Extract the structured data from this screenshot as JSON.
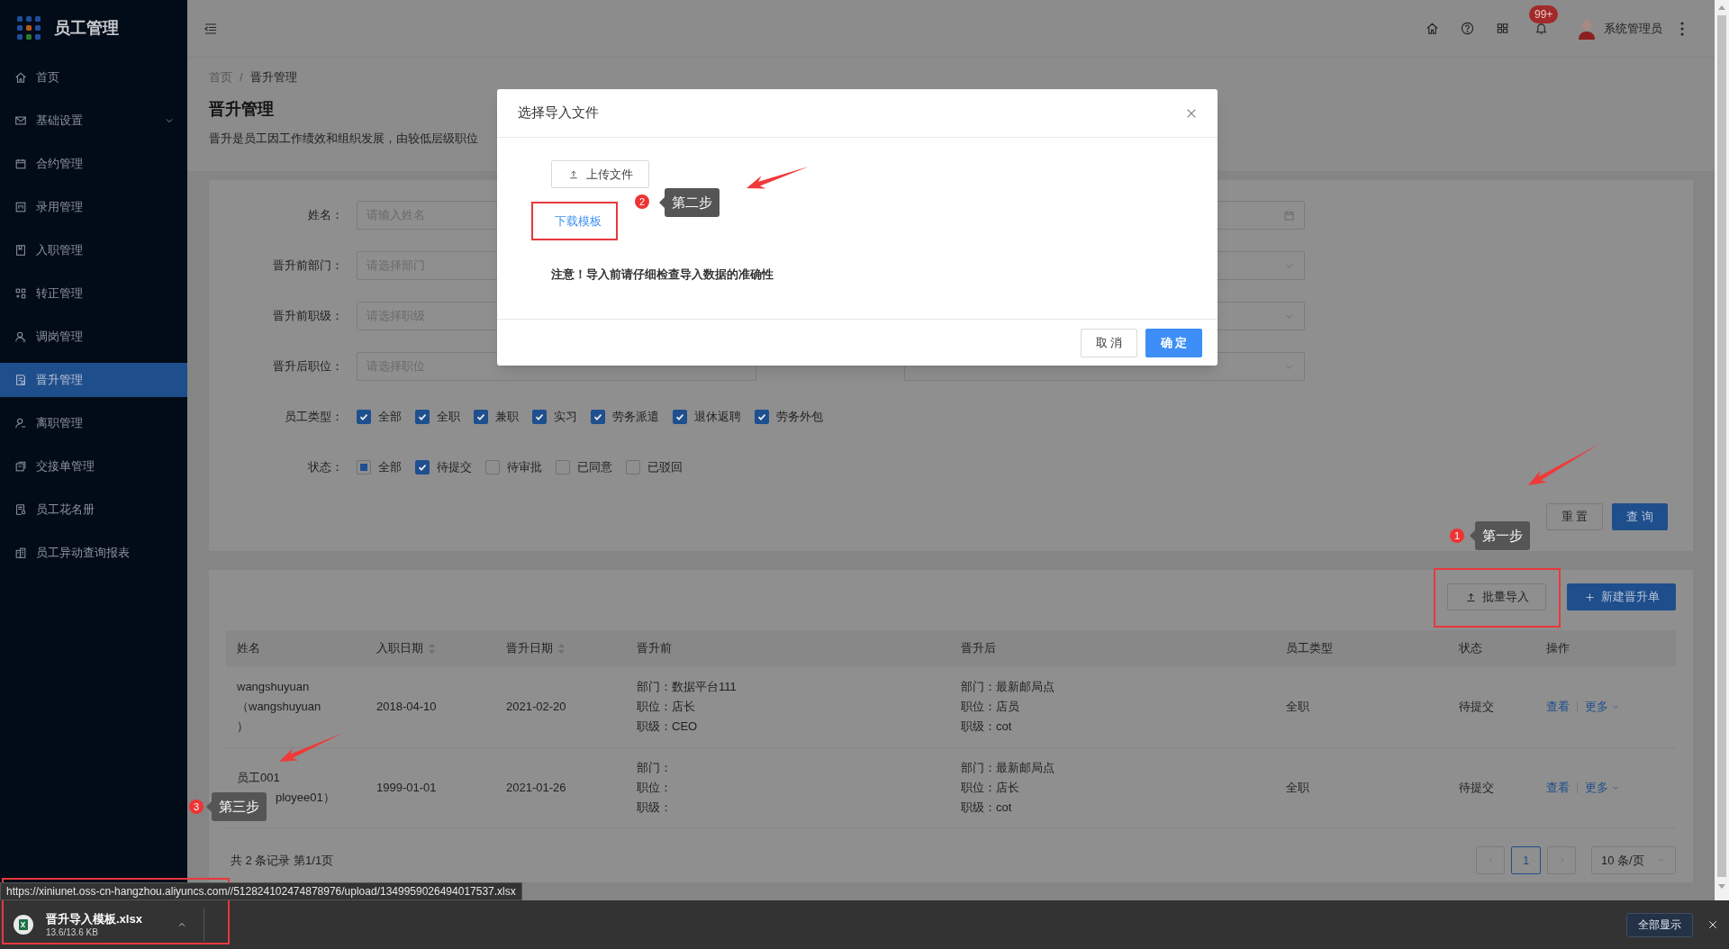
{
  "app": {
    "title": "员工管理"
  },
  "sidebar": {
    "items": [
      {
        "label": "首页",
        "kind": "link",
        "selected": false
      },
      {
        "label": "基础设置",
        "kind": "submenu",
        "selected": false
      },
      {
        "label": "合约管理",
        "kind": "link",
        "selected": false
      },
      {
        "label": "录用管理",
        "kind": "link",
        "selected": false
      },
      {
        "label": "入职管理",
        "kind": "link",
        "selected": false
      },
      {
        "label": "转正管理",
        "kind": "link",
        "selected": false
      },
      {
        "label": "调岗管理",
        "kind": "link",
        "selected": false
      },
      {
        "label": "晋升管理",
        "kind": "link",
        "selected": true
      },
      {
        "label": "离职管理",
        "kind": "link",
        "selected": false
      },
      {
        "label": "交接单管理",
        "kind": "link",
        "selected": false
      },
      {
        "label": "员工花名册",
        "kind": "link",
        "selected": false
      },
      {
        "label": "员工异动查询报表",
        "kind": "link",
        "selected": false
      }
    ]
  },
  "header": {
    "notification_badge": "99+",
    "user": "系统管理员"
  },
  "breadcrumb": [
    "首页",
    "晋升管理"
  ],
  "breadcrumb_separator": "/",
  "page": {
    "title": "晋升管理",
    "description": "晋升是员工因工作绩效和组织发展，由较低层级职位"
  },
  "filters": {
    "rows": [
      {
        "label": "姓名：",
        "placeholder": "请输入姓名",
        "right": {
          "kind": "date"
        }
      },
      {
        "label": "晋升前部门：",
        "placeholder": "请选择部门",
        "right": {
          "kind": "select"
        }
      },
      {
        "label": "晋升前职级：",
        "placeholder": "请选择职级",
        "right": {
          "kind": "select"
        }
      },
      {
        "label": "晋升后职位：",
        "placeholder": "请选择职位",
        "right": {
          "kind": "select"
        }
      }
    ],
    "employee_type": {
      "label": "员工类型：",
      "all_option": {
        "label": "全部",
        "checked": true
      },
      "options": [
        {
          "label": "全职",
          "checked": true
        },
        {
          "label": "兼职",
          "checked": true
        },
        {
          "label": "实习",
          "checked": true
        },
        {
          "label": "劳务派遣",
          "checked": true
        },
        {
          "label": "退休返聘",
          "checked": true
        },
        {
          "label": "劳务外包",
          "checked": true
        }
      ]
    },
    "status": {
      "label": "状态：",
      "all_option": {
        "label": "全部",
        "checked": false
      },
      "options": [
        {
          "label": "待提交",
          "checked": true
        },
        {
          "label": "待审批",
          "checked": false
        },
        {
          "label": "已同意",
          "checked": false
        },
        {
          "label": "已驳回",
          "checked": false
        }
      ]
    },
    "reset": "重 置",
    "query": "查 询"
  },
  "table": {
    "toolbar": {
      "import": "批量导入",
      "create": "新建晋升单"
    },
    "columns": [
      {
        "label": "姓名",
        "sortable": false
      },
      {
        "label": "入职日期",
        "sortable": true
      },
      {
        "label": "晋升日期",
        "sortable": true
      },
      {
        "label": "晋升前",
        "sortable": false
      },
      {
        "label": "晋升后",
        "sortable": false
      },
      {
        "label": "员工类型",
        "sortable": false
      },
      {
        "label": "状态",
        "sortable": false
      },
      {
        "label": "操作",
        "sortable": false
      }
    ],
    "rows": [
      {
        "name_lines": [
          "wangshuyuan",
          "（wangshuyuan",
          "）"
        ],
        "hire_date": "2018-04-10",
        "promotion_date": "2021-02-20",
        "before": [
          "部门：数据平台111",
          "职位：店长",
          "职级：CEO"
        ],
        "after": [
          "部门：最新邮局点",
          "职位：店员",
          "职级：cot"
        ],
        "employee_type": "全职",
        "status": "待提交",
        "view": "查看",
        "more": "更多"
      },
      {
        "name_lines": [
          "员工001",
          "ployee01）"
        ],
        "hire_date": "1999-01-01",
        "promotion_date": "2021-01-26",
        "before": [
          "部门：",
          "职位：",
          "职级："
        ],
        "after": [
          "部门：最新邮局点",
          "职位：店长",
          "职级：cot"
        ],
        "employee_type": "全职",
        "status": "待提交",
        "view": "查看",
        "more": "更多"
      }
    ],
    "summary": "共 2 条记录 第1/1页",
    "pages": [
      {
        "label": "1",
        "selected": true
      }
    ],
    "page_size": "10 条/页"
  },
  "modal": {
    "title": "选择导入文件",
    "upload": "上传文件",
    "template_link": "下载模板",
    "note": "注意！导入前请仔细检查导入数据的准确性",
    "cancel": "取 消",
    "ok": "确 定"
  },
  "annotations": [
    {
      "number": "1",
      "label": "第一步"
    },
    {
      "number": "2",
      "label": "第二步"
    },
    {
      "number": "3",
      "label": "第三步"
    }
  ],
  "status_url": "https://xiniunet.oss-cn-hangzhou.aliyuncs.com//512824102474878976/upload/1349959026494017537.xlsx",
  "download_bar": {
    "file_name": "晋升导入模板.xlsx",
    "size": "13.6/13.6 KB",
    "show_all": "全部显示"
  }
}
